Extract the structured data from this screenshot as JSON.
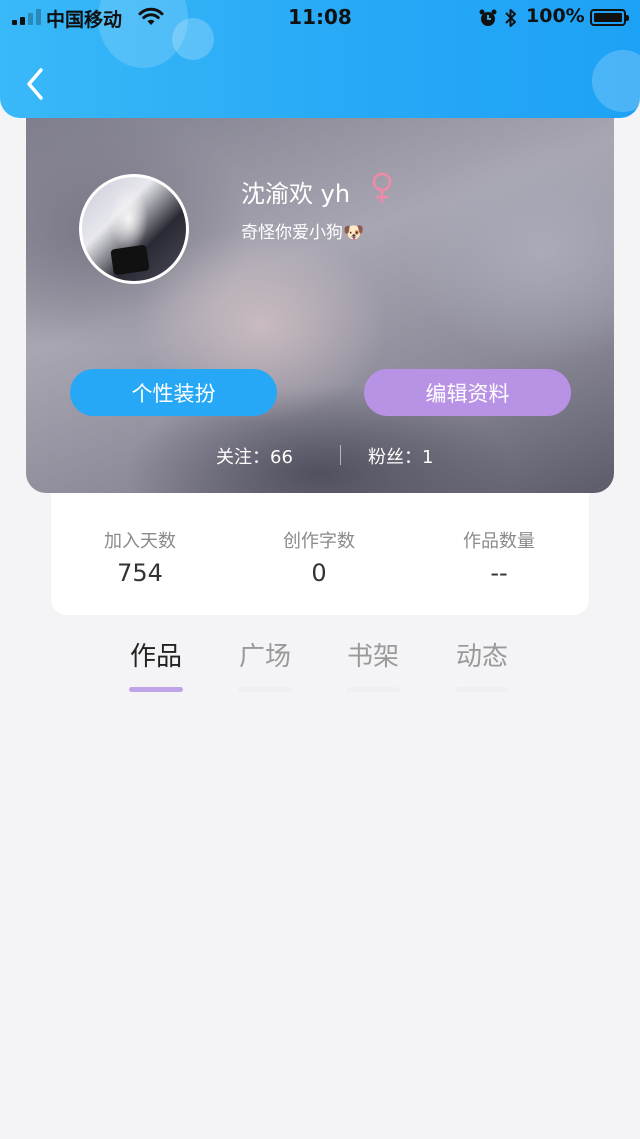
{
  "status_bar": {
    "carrier": "中国移动",
    "time": "11:08",
    "battery": "100%"
  },
  "profile": {
    "username": "沈渝欢 yh",
    "bio": "奇怪你爱小狗🐶",
    "gender_color": "#f08aa8",
    "dressup_button": "个性装扮",
    "edit_button": "编辑资料",
    "follow_label": "关注：",
    "follow_count": "66",
    "fans_label": "粉丝：",
    "fans_count": "1"
  },
  "stats": [
    {
      "label": "加入天数",
      "value": "754"
    },
    {
      "label": "创作字数",
      "value": "0"
    },
    {
      "label": "作品数量",
      "value": "--"
    }
  ],
  "tabs": [
    {
      "label": "作品",
      "active": true
    },
    {
      "label": "广场",
      "active": false
    },
    {
      "label": "书架",
      "active": false
    },
    {
      "label": "动态",
      "active": false
    }
  ],
  "colors": {
    "header_blue": "#27a9f6",
    "dressup_blue": "#27a8f6",
    "edit_purple": "#b893e5",
    "tab_indicator": "#c0a2e8"
  }
}
